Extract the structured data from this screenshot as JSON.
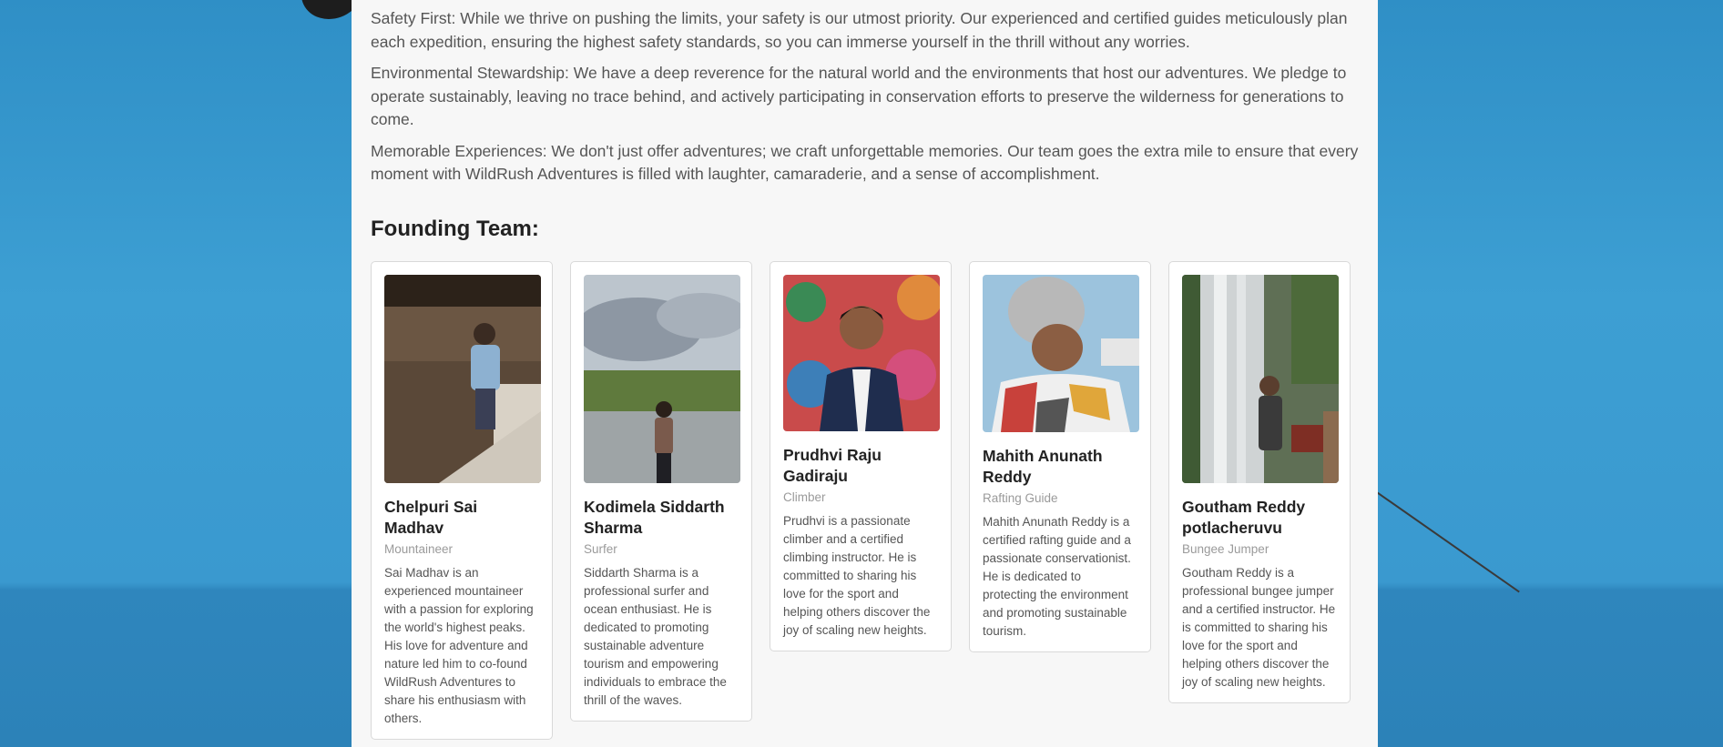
{
  "about": {
    "paragraphs": [
      "Safety First: While we thrive on pushing the limits, your safety is our utmost priority. Our experienced and certified guides meticulously plan each expedition, ensuring the highest safety standards, so you can immerse yourself in the thrill without any worries.",
      "Environmental Stewardship: We have a deep reverence for the natural world and the environments that host our adventures. We pledge to operate sustainably, leaving no trace behind, and actively participating in conservation efforts to preserve the wilderness for generations to come.",
      "Memorable Experiences: We don't just offer adventures; we craft unforgettable memories. Our team goes the extra mile to ensure that every moment with WildRush Adventures is filled with laughter, camaraderie, and a sense of accomplishment."
    ]
  },
  "team": {
    "title": "Founding Team:",
    "members": [
      {
        "name": "Chelpuri Sai Madhav",
        "role": "Mountaineer",
        "bio": "Sai Madhav is an experienced mountaineer with a passion for exploring the world's highest peaks. His love for adventure and nature led him to co-found WildRush Adventures to share his enthusiasm with others."
      },
      {
        "name": "Kodimela Siddarth Sharma",
        "role": "Surfer",
        "bio": "Siddarth Sharma is a professional surfer and ocean enthusiast. He is dedicated to promoting sustainable adventure tourism and empowering individuals to embrace the thrill of the waves."
      },
      {
        "name": "Prudhvi Raju Gadiraju",
        "role": "Climber",
        "bio": "Prudhvi is a passionate climber and a certified climbing instructor. He is committed to sharing his love for the sport and helping others discover the joy of scaling new heights."
      },
      {
        "name": "Mahith Anunath Reddy",
        "role": "Rafting Guide",
        "bio": "Mahith Anunath Reddy is a certified rafting guide and a passionate conservationist. He is dedicated to protecting the environment and promoting sustainable tourism."
      },
      {
        "name": "Goutham Reddy potlacheruvu",
        "role": "Bungee Jumper",
        "bio": "Goutham Reddy is a professional bungee jumper and a certified instructor. He is committed to sharing his love for the sport and helping others discover the joy of scaling new heights."
      }
    ]
  }
}
